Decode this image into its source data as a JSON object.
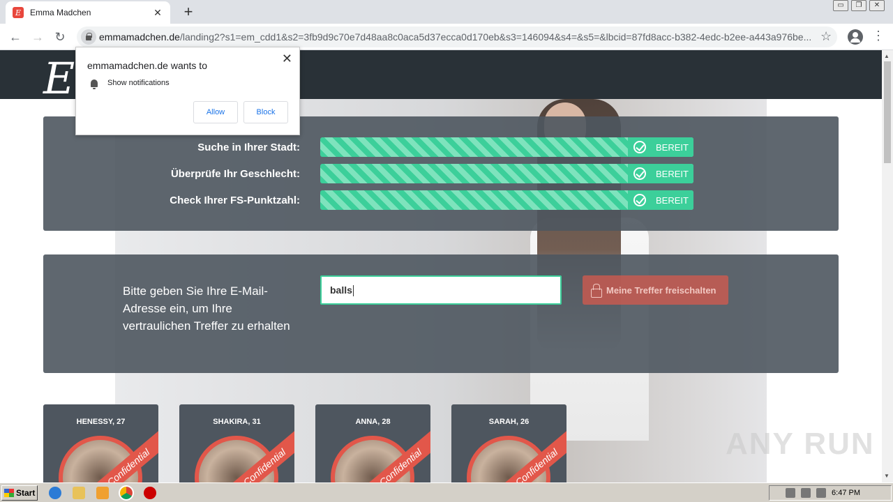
{
  "browser": {
    "tab_title": "Emma Madchen",
    "tab_favicon_letter": "E",
    "url_host": "emmamadchen.de",
    "url_path": "/landing2?s1=em_cdd1&s2=3fb9d9c70e7d48aa8c0aca5d37ecca0d170eb&s3=146094&s4=&s5=&lbcid=87fd8acc-b382-4edc-b2ee-a443a976be...",
    "window_buttons": [
      "▭",
      "❐",
      "✕"
    ]
  },
  "notification_popup": {
    "title": "emmamadchen.de wants to",
    "permission": "Show notifications",
    "allow_label": "Allow",
    "block_label": "Block"
  },
  "site": {
    "logo_letter": "E",
    "progress_rows": [
      {
        "label": "Suche in Ihrer Stadt:",
        "status": "BEREIT",
        "progress": 1.0
      },
      {
        "label": "Überprüfe Ihr Geschlecht:",
        "status": "BEREIT",
        "progress": 1.0
      },
      {
        "label": "Check Ihrer FS-Punktzahl:",
        "status": "BEREIT",
        "progress": 1.0
      }
    ],
    "email_prompt": "Bitte geben Sie Ihre E-Mail-Adresse ein, um Ihre vertraulichen Treffer zu erhalten",
    "email_value": "balls",
    "unlock_button": "Meine Treffer freischalten",
    "profiles": [
      {
        "name": "HENESSY, 27",
        "ribbon": "Confidential"
      },
      {
        "name": "SHAKIRA, 31",
        "ribbon": "Confidential"
      },
      {
        "name": "ANNA, 28",
        "ribbon": "Confidential"
      },
      {
        "name": "SARAH, 26",
        "ribbon": "Confidential"
      }
    ],
    "watermark": "ANY RUN"
  },
  "taskbar": {
    "start_label": "Start",
    "clock": "6:47 PM"
  },
  "colors": {
    "accent_green": "#3ccf9a",
    "accent_red": "#e2574a",
    "panel": "#4e565f",
    "header": "#293137"
  }
}
